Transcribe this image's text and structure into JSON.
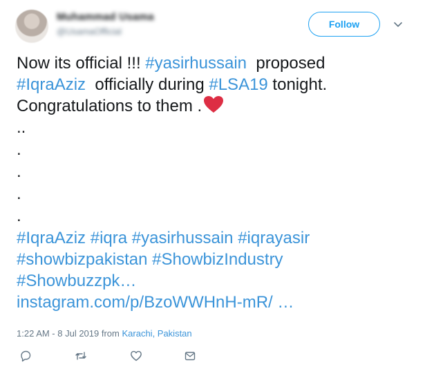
{
  "user": {
    "name": "Muhammad Usama",
    "handle": "@UsamaOfficial"
  },
  "follow_label": "Follow",
  "tweet": {
    "line1_text": "Now its official !!! ",
    "line1_tag": "#yasirhussain",
    "line1_text2": "  proposed",
    "line2_tag1": "#IqraAziz",
    "line2_text": "  officially during ",
    "line2_tag2": "#LSA19",
    "line2_text2": " tonight.",
    "line3_text": "Congratulations to them .",
    "dots": [
      "..",
      ".",
      ".",
      ".",
      "."
    ],
    "tags_line1": [
      "#IqraAziz",
      "#iqra",
      "#yasirhussain",
      "#iqrayasir"
    ],
    "tags_line2": [
      "#showbizpakistan",
      "#ShowbizIndustry"
    ],
    "tags_line3": "#Showbuzzpk…",
    "link": "instagram.com/p/BzoWWHnH-mR/ …"
  },
  "meta": {
    "time": "1:22 AM - 8 Jul 2019",
    "from_label": " from ",
    "location": "Karachi, Pakistan"
  },
  "colors": {
    "link": "#3b94d9",
    "follow": "#1da1f2",
    "heart": "#dd2e44",
    "muted": "#657786"
  },
  "icons": [
    "chevron-down-icon",
    "heart-icon",
    "reply-icon",
    "retweet-icon",
    "like-icon",
    "message-icon"
  ]
}
